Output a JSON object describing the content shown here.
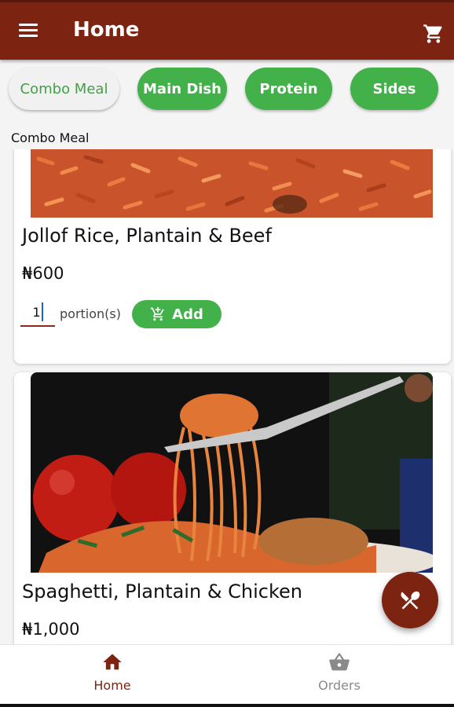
{
  "app_bar": {
    "title": "Home",
    "menu_icon": "hamburger-menu-icon",
    "cart_icon": "shopping-cart-icon"
  },
  "categories": [
    {
      "label": "Combo Meal",
      "selected": true
    },
    {
      "label": "Main Dish",
      "selected": false
    },
    {
      "label": "Protein",
      "selected": false
    },
    {
      "label": "Sides",
      "selected": false
    }
  ],
  "section_label": "Combo Meal",
  "products": [
    {
      "name": "Jollof Rice, Plantain & Beef",
      "price": "₦600",
      "quantity": "1",
      "portion_label": "portion(s)",
      "add_label": "Add"
    },
    {
      "name": "Spaghetti, Plantain & Chicken",
      "price": "₦1,000"
    }
  ],
  "fab": {
    "icon": "fork-knife-icon"
  },
  "bottom_nav": [
    {
      "label": "Home",
      "icon": "home-icon",
      "active": true
    },
    {
      "label": "Orders",
      "icon": "basket-icon",
      "active": false
    }
  ],
  "colors": {
    "primary": "#7d2312",
    "accent_green": "#43b14a",
    "nav_inactive": "#8a8a8a"
  }
}
